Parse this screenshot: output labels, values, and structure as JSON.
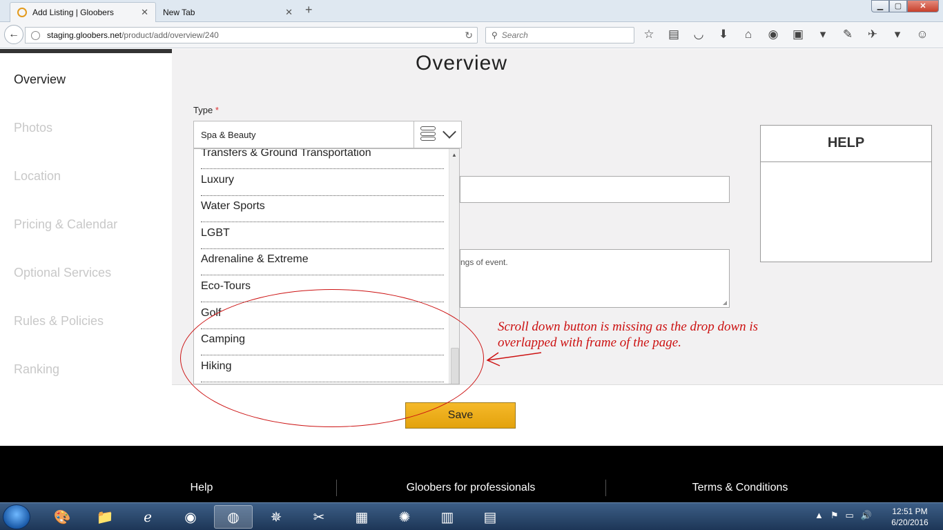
{
  "browser": {
    "tabs": [
      {
        "label": "Add Listing | Gloobers",
        "close": "✕"
      },
      {
        "label": "New Tab",
        "close": "✕"
      }
    ],
    "url": {
      "host": "staging.gloobers.net",
      "path": "/product/add/overview/240"
    },
    "search_placeholder": "Search"
  },
  "sidebar": {
    "items": [
      {
        "label": "Overview"
      },
      {
        "label": "Photos"
      },
      {
        "label": "Location"
      },
      {
        "label": "Pricing & Calendar"
      },
      {
        "label": "Optional Services"
      },
      {
        "label": "Rules & Policies"
      },
      {
        "label": "Ranking"
      }
    ]
  },
  "main": {
    "title": "Overview",
    "type_label": "Type",
    "required_mark": "*",
    "type_value": "Spa & Beauty",
    "options": [
      "Transfers & Ground Transportation",
      "Luxury",
      "Water Sports",
      "LGBT",
      "Adrenaline & Extreme",
      "Eco-Tours",
      "Golf",
      "Camping",
      "Hiking"
    ],
    "description_partial": "ngs of event.",
    "save_label": "Save"
  },
  "help": {
    "title": "HELP"
  },
  "annotation": {
    "text": "Scroll down button is missing as the drop down is overlapped with frame of the page.",
    "color": "#cc1111"
  },
  "footer": {
    "links": [
      "Help",
      "Gloobers for professionals",
      "Terms & Conditions"
    ]
  },
  "taskbar": {
    "time": "12:51 PM",
    "date": "6/20/2016"
  }
}
